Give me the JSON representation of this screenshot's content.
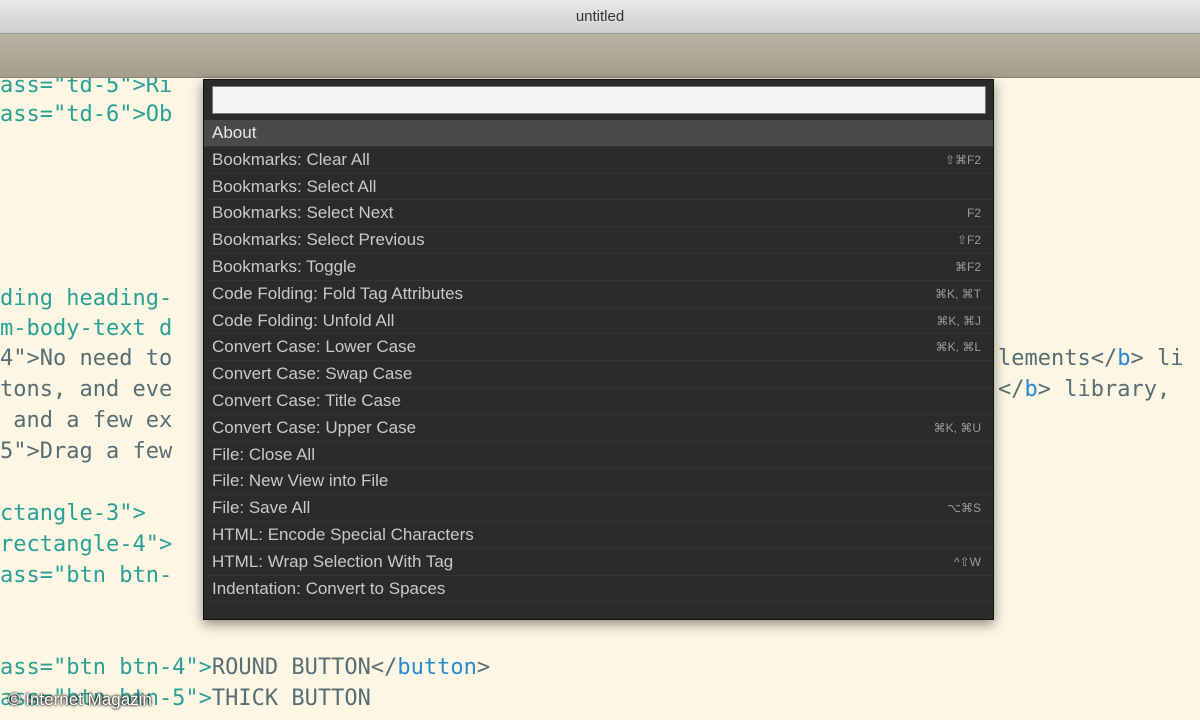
{
  "window": {
    "title": "untitled"
  },
  "code_lines": [
    {
      "segments": [
        {
          "t": "ass=\"td-5\">Ri",
          "k": "cls"
        }
      ]
    },
    {
      "segments": [
        {
          "t": "ass=\"td-6\">Ob",
          "k": "cls"
        }
      ]
    },
    {
      "segments": [
        {
          "t": "ding heading-",
          "k": "cls"
        }
      ]
    },
    {
      "segments": [
        {
          "t": "m-body-text d",
          "k": "cls"
        }
      ]
    },
    {
      "segments": [
        {
          "t": "4\">No need to",
          "k": ""
        }
      ]
    },
    {
      "segments": [
        {
          "t": "tons, and eve",
          "k": ""
        }
      ]
    },
    {
      "segments": [
        {
          "t": " and a few ex",
          "k": ""
        }
      ]
    },
    {
      "segments": [
        {
          "t": "5\">Drag a few",
          "k": ""
        }
      ]
    },
    {
      "segments": [
        {
          "t": "ctangle-3\">",
          "k": "cls"
        }
      ]
    },
    {
      "segments": [
        {
          "t": "rectangle-4\">",
          "k": "cls"
        }
      ]
    },
    {
      "segments": [
        {
          "t": "ass=\"btn btn-",
          "k": "cls"
        }
      ]
    },
    {
      "segments": [
        {
          "t": "ass=\"btn btn-4\">",
          "k": "cls"
        },
        {
          "t": "ROUND BUTTON",
          "k": ""
        },
        {
          "t": "</",
          "k": ""
        },
        {
          "t": "button",
          "k": "tag"
        },
        {
          "t": ">",
          "k": ""
        }
      ]
    },
    {
      "segments": [
        {
          "t": "ass=\"btn btn-5\">",
          "k": "cls"
        },
        {
          "t": "THICK BUTTON",
          "k": ""
        }
      ]
    },
    {
      "segments": [
        {
          "t": "lements</",
          "k": ""
        },
        {
          "t": "b",
          "k": "tag"
        },
        {
          "t": "> li",
          "k": ""
        }
      ]
    },
    {
      "segments": [
        {
          "t": "</",
          "k": ""
        },
        {
          "t": "b",
          "k": "tag"
        },
        {
          "t": "> library,",
          "k": ""
        }
      ]
    }
  ],
  "palette": {
    "input_value": "",
    "items": [
      {
        "label": "About",
        "shortcut": ""
      },
      {
        "label": "Bookmarks: Clear All",
        "shortcut": "⇧⌘F2"
      },
      {
        "label": "Bookmarks: Select All",
        "shortcut": ""
      },
      {
        "label": "Bookmarks: Select Next",
        "shortcut": "F2"
      },
      {
        "label": "Bookmarks: Select Previous",
        "shortcut": "⇧F2"
      },
      {
        "label": "Bookmarks: Toggle",
        "shortcut": "⌘F2"
      },
      {
        "label": "Code Folding: Fold Tag Attributes",
        "shortcut": "⌘K, ⌘T"
      },
      {
        "label": "Code Folding: Unfold All",
        "shortcut": "⌘K, ⌘J"
      },
      {
        "label": "Convert Case: Lower Case",
        "shortcut": "⌘K, ⌘L"
      },
      {
        "label": "Convert Case: Swap Case",
        "shortcut": ""
      },
      {
        "label": "Convert Case: Title Case",
        "shortcut": ""
      },
      {
        "label": "Convert Case: Upper Case",
        "shortcut": "⌘K, ⌘U"
      },
      {
        "label": "File: Close All",
        "shortcut": ""
      },
      {
        "label": "File: New View into File",
        "shortcut": ""
      },
      {
        "label": "File: Save All",
        "shortcut": "⌥⌘S"
      },
      {
        "label": "HTML: Encode Special Characters",
        "shortcut": ""
      },
      {
        "label": "HTML: Wrap Selection With Tag",
        "shortcut": "^⇧W"
      },
      {
        "label": "Indentation: Convert to Spaces",
        "shortcut": ""
      }
    ]
  },
  "watermark": "© Internet Magazin"
}
